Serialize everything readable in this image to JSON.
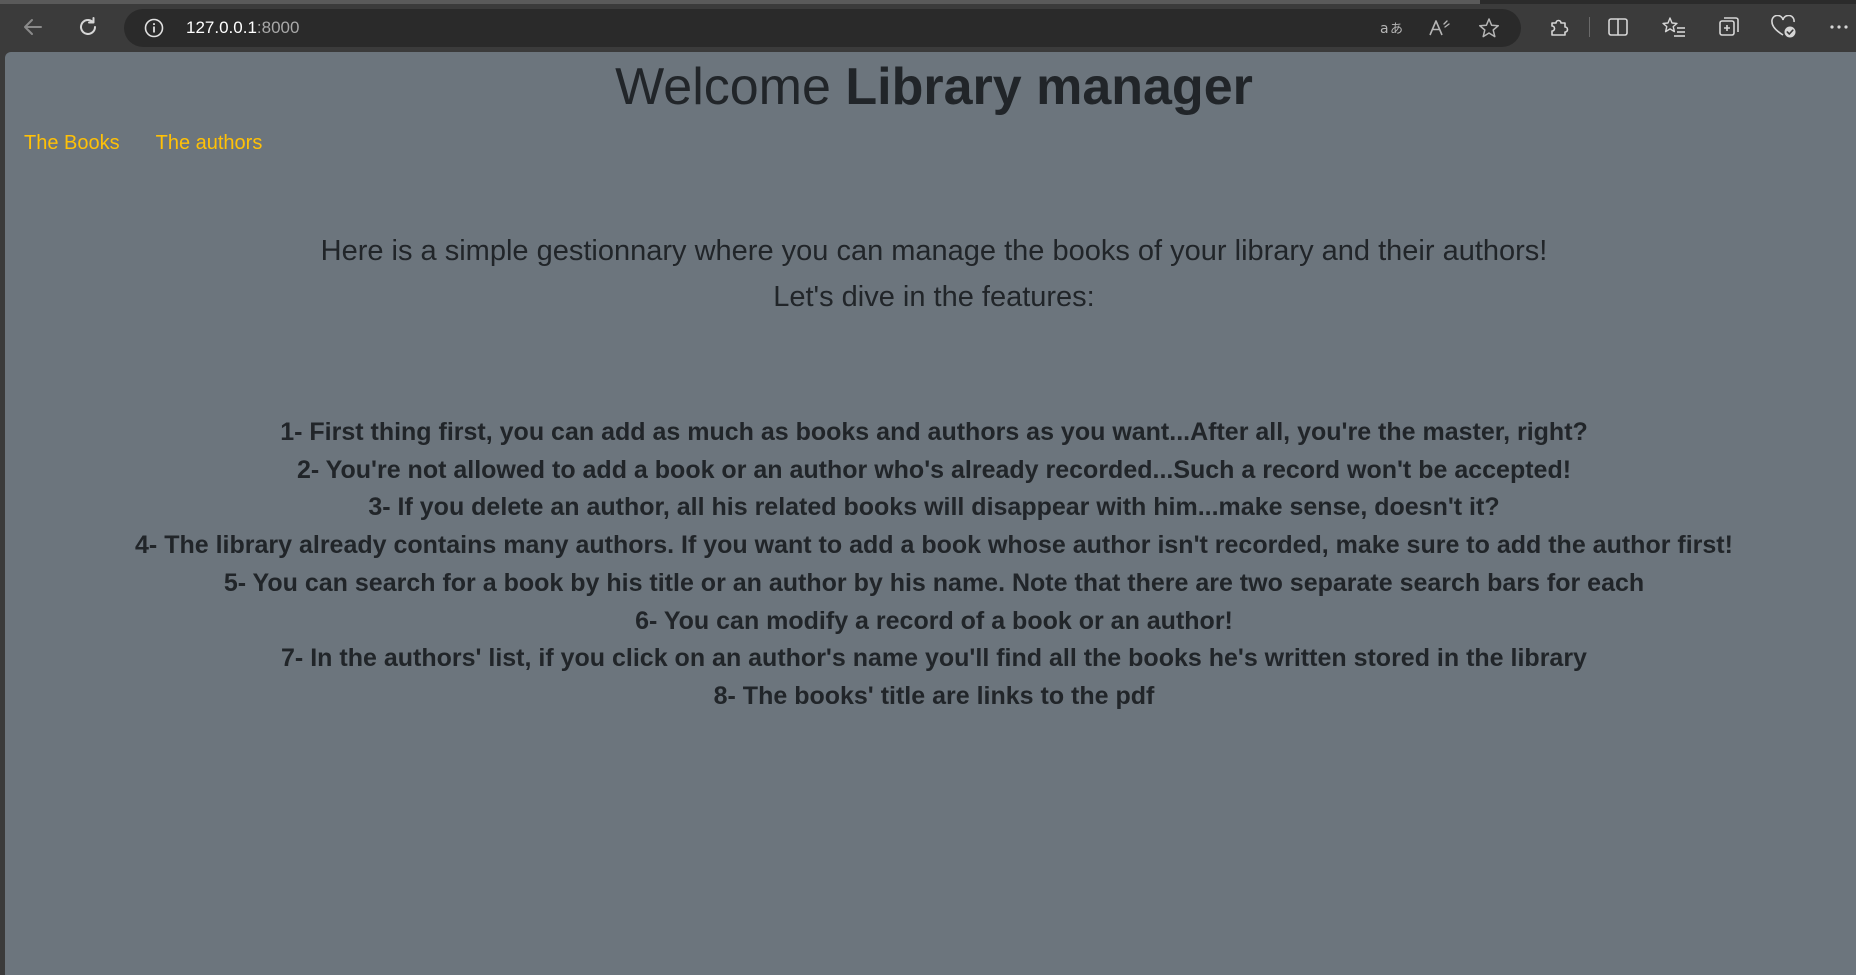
{
  "browser": {
    "url_host": "127.0.0.1",
    "url_port": ":8000"
  },
  "page": {
    "title_plain": "Welcome ",
    "title_bold": "Library manager",
    "nav": [
      {
        "label": "The Books"
      },
      {
        "label": "The authors"
      }
    ],
    "intro": [
      "Here is a simple gestionnary where you can manage the books of your library and their authors!",
      "Let's dive in the features:"
    ],
    "features": [
      {
        "prefix": "1- ",
        "emphasis": "First thing first",
        "text": ", you can add as much as books and authors as you want...After all, you're the master, right?"
      },
      {
        "prefix": "",
        "emphasis": "",
        "text": "2- You're not allowed to add a book or an author who's already recorded...Such a record won't be accepted!"
      },
      {
        "prefix": "",
        "emphasis": "",
        "text": "3- If you delete an author, all his related books will disappear with him...make sense, doesn't it?"
      },
      {
        "prefix": "",
        "emphasis": "",
        "text": "4- The library already contains many authors. If you want to add a book whose author isn't recorded, make sure to add the author first!"
      },
      {
        "prefix": "",
        "emphasis": "",
        "text": "5- You can search for a book by his title or an author by his name. Note that there are two separate search bars for each"
      },
      {
        "prefix": "",
        "emphasis": "",
        "text": "6- You can modify a record of a book or an author!"
      },
      {
        "prefix": "",
        "emphasis": "",
        "text": "7- In the authors' list, if you click on an author's name you'll find all the books he's written stored in the library"
      },
      {
        "prefix": "",
        "emphasis": "",
        "text": "8- The books' title are links to the pdf"
      }
    ]
  },
  "icons": {
    "back": "back-arrow-icon",
    "refresh": "refresh-icon",
    "info": "info-icon",
    "translate": "translate-icon",
    "read_aloud": "read-aloud-icon",
    "favorite": "star-icon",
    "extensions": "puzzle-icon",
    "split_screen": "split-screen-icon",
    "favorites": "favorites-list-icon",
    "collections": "collections-icon",
    "browser_essentials": "browser-essentials-icon",
    "more": "more-icon"
  },
  "colors": {
    "page_background": "#6c757d",
    "link": "#ffc107",
    "text": "#212529",
    "chrome": "#3b3b3b"
  }
}
